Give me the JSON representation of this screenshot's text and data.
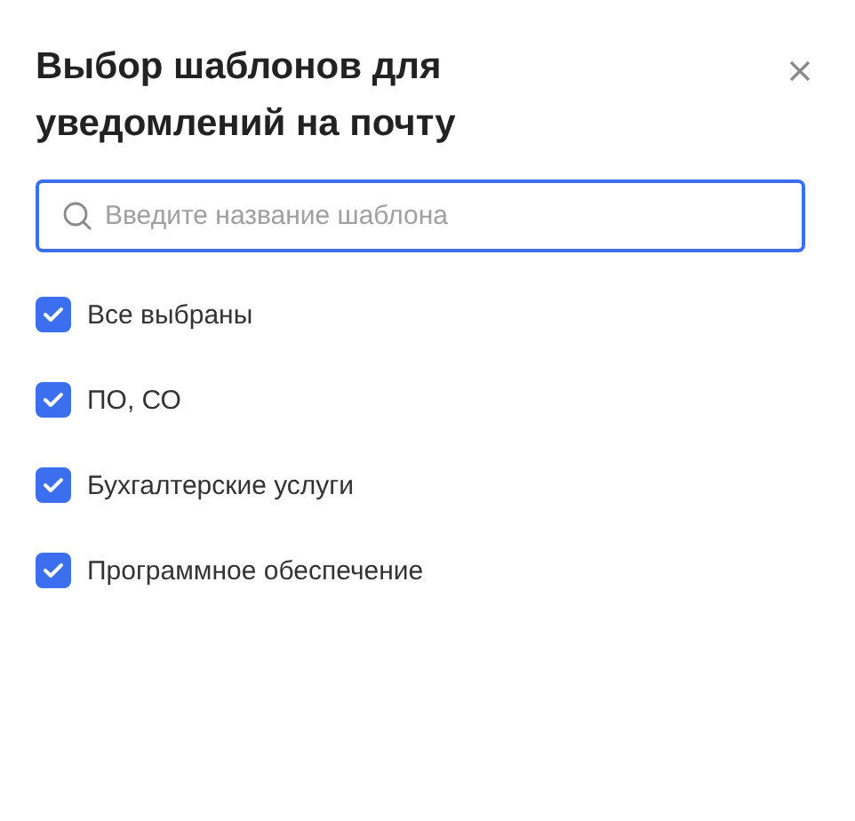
{
  "dialog": {
    "title": "Выбор шаблонов для уведомлений на почту"
  },
  "search": {
    "placeholder": "Введите название шаблона"
  },
  "options": [
    {
      "label": "Все выбраны",
      "checked": true
    },
    {
      "label": "ПО, СО",
      "checked": true
    },
    {
      "label": "Бухгалтерские услуги",
      "checked": true
    },
    {
      "label": "Программное обеспечение",
      "checked": true
    }
  ]
}
